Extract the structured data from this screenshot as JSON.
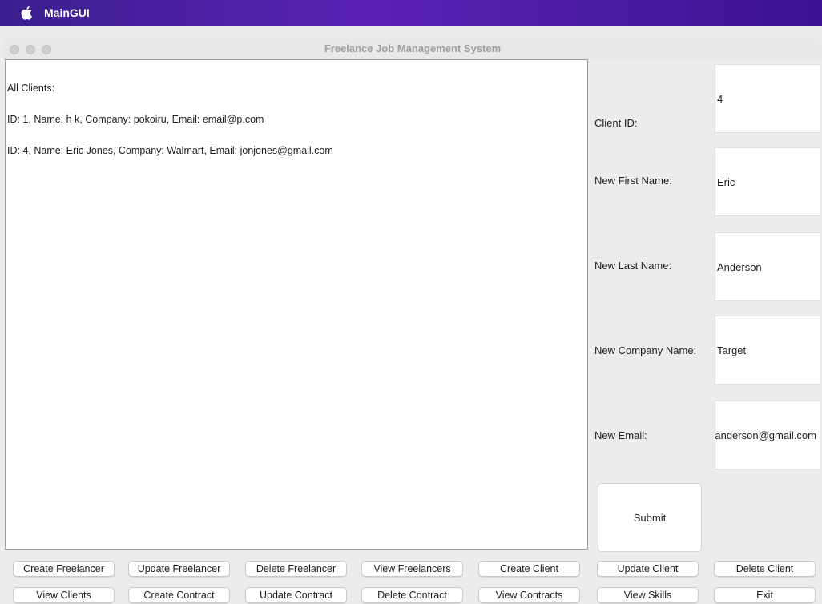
{
  "menubar": {
    "app_name": "MainGUI"
  },
  "window": {
    "title": "Freelance Job Management System"
  },
  "output": {
    "lines": [
      "All Clients:",
      "ID: 1, Name: h k, Company: pokoiru, Email: email@p.com",
      "ID: 4, Name: Eric Jones, Company: Walmart, Email: jonjones@gmail.com"
    ]
  },
  "form": {
    "fields": [
      {
        "label": "Client ID:",
        "value": "4"
      },
      {
        "label": "New First Name:",
        "value": "Eric"
      },
      {
        "label": "New Last Name:",
        "value": "Anderson"
      },
      {
        "label": "New Company Name:",
        "value": "Target"
      },
      {
        "label": "New Email:",
        "value": "ericanderson@gmail.com"
      }
    ],
    "submit_label": "Submit"
  },
  "buttons": {
    "row1": [
      "Create Freelancer",
      "Update Freelancer",
      "Delete Freelancer",
      "View Freelancers",
      "Create Client",
      "Update Client",
      "Delete Client"
    ],
    "row2": [
      "View Clients",
      "Create Contract",
      "Update Contract",
      "Delete Contract",
      "View Contracts",
      "View Skills",
      "Exit"
    ]
  },
  "icons": {
    "menubar_logo": "apple-icon"
  },
  "colors": {
    "menubar_accent": "#4a1aa2"
  }
}
